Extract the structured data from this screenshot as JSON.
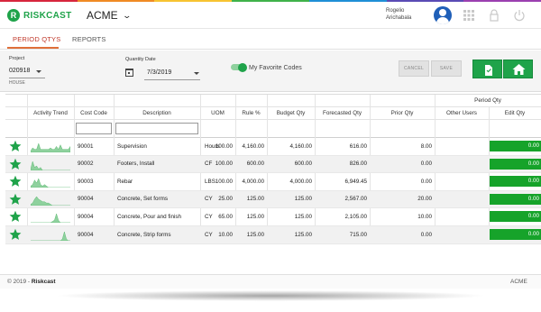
{
  "brand": {
    "logo_text": "RISKCAST",
    "accent": "#1fa34a",
    "rainbow": [
      "#d7263d",
      "#f08a24",
      "#f7c331",
      "#3fb24a",
      "#1f8fd6",
      "#5a4bb5",
      "#9b3fb0"
    ]
  },
  "topbar": {
    "company": "ACME",
    "user_first": "Rogelio",
    "user_last": "Arichabala",
    "icons": [
      "grid-icon",
      "lock-icon",
      "power-icon"
    ]
  },
  "tabs": [
    {
      "label": "PERIOD QTYS",
      "active": true
    },
    {
      "label": "REPORTS",
      "active": false
    }
  ],
  "filters": {
    "project_label": "Project",
    "project_value": "020918",
    "project_sub": "HOUSE",
    "quantity_date_label": "Quantity Date",
    "quantity_date_value": "7/3/2019",
    "favorites_label": "My Favorite Codes",
    "favorites_on": true,
    "cancel_label": "CANCEL",
    "save_label": "SAVE"
  },
  "grid": {
    "group_header": "Period Qty",
    "columns": [
      "Activity Trend",
      "Cost Code",
      "Description",
      "UOM",
      "Rule %",
      "Budget Qty",
      "Forecasted Qty",
      "Prior Qty",
      "Other Users",
      "Edit Qty"
    ],
    "rows": [
      {
        "cost_code": "90001",
        "description": "Supervision",
        "uom": "Hours",
        "rule": "100.00",
        "budget": "4,160.00",
        "forecast": "4,160.00",
        "prior": "616.00",
        "other": "8.00",
        "edit": "0.00",
        "trend": [
          1,
          3,
          2,
          2,
          6,
          2,
          2,
          2,
          2,
          2,
          3,
          2,
          2,
          4,
          2,
          5,
          2,
          2,
          2,
          2,
          4
        ]
      },
      {
        "cost_code": "90002",
        "description": "Footers, Install",
        "uom": "CF",
        "rule": "100.00",
        "budget": "600.00",
        "forecast": "600.00",
        "prior": "826.00",
        "other": "0.00",
        "edit": "0.00",
        "trend": [
          1,
          6,
          2,
          3,
          1,
          2,
          0,
          0,
          0,
          0,
          0,
          0,
          0,
          0,
          0,
          0,
          0,
          0,
          0,
          0,
          0
        ]
      },
      {
        "cost_code": "90003",
        "description": "Rebar",
        "uom": "LBS",
        "rule": "100.00",
        "budget": "4,000.00",
        "forecast": "4,000.00",
        "prior": "6,949.45",
        "other": "0.00",
        "edit": "0.00",
        "trend": [
          1,
          2,
          5,
          3,
          6,
          2,
          1,
          2,
          1,
          0,
          0,
          0,
          0,
          0,
          0,
          0,
          0,
          0,
          0,
          0,
          0
        ]
      },
      {
        "cost_code": "90004",
        "description": "Concrete, Set forms",
        "uom": "CY",
        "rule": "25.00",
        "budget": "125.00",
        "forecast": "125.00",
        "prior": "2,567.00",
        "other": "20.00",
        "edit": "0.00",
        "trend": [
          1,
          2,
          5,
          7,
          5,
          4,
          3,
          3,
          2,
          2,
          1,
          0,
          0,
          0,
          0,
          0,
          0,
          0,
          0,
          0,
          0
        ]
      },
      {
        "cost_code": "90004",
        "description": "Concrete, Pour and finish",
        "uom": "CY",
        "rule": "65.00",
        "budget": "125.00",
        "forecast": "125.00",
        "prior": "2,105.00",
        "other": "10.00",
        "edit": "0.00",
        "trend": [
          0,
          0,
          0,
          0,
          0,
          0,
          0,
          0,
          0,
          0,
          0,
          1,
          2,
          7,
          2,
          0,
          0,
          0,
          0,
          0,
          0
        ]
      },
      {
        "cost_code": "90004",
        "description": "Concrete, Strip forms",
        "uom": "CY",
        "rule": "10.00",
        "budget": "125.00",
        "forecast": "125.00",
        "prior": "715.00",
        "other": "0.00",
        "edit": "0.00",
        "trend": [
          0,
          0,
          0,
          0,
          0,
          0,
          0,
          0,
          0,
          0,
          0,
          0,
          0,
          0,
          0,
          0,
          1,
          5,
          1,
          0,
          0
        ]
      }
    ]
  },
  "footer": {
    "copyright_prefix": "© 2019 - ",
    "copyright_brand": "Riskcast",
    "org": "ACME"
  }
}
